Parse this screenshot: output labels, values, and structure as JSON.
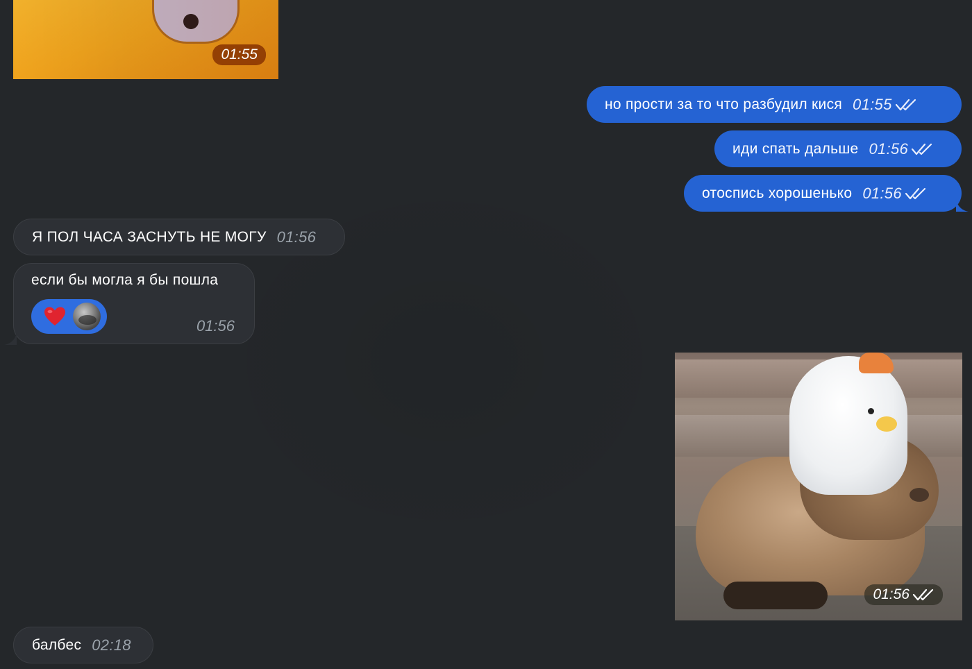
{
  "media_top": {
    "time": "01:55"
  },
  "outgoing": [
    {
      "text": "но прости за то что разбудил кися",
      "time": "01:55"
    },
    {
      "text": "иди спать дальше",
      "time": "01:56"
    },
    {
      "text": "отоспись хорошенько",
      "time": "01:56"
    }
  ],
  "incoming": [
    {
      "text": "Я ПОЛ ЧАСА ЗАСНУТЬ НЕ МОГУ",
      "time": "01:56"
    },
    {
      "text": "если бы могла я бы пошла",
      "time": "01:56",
      "reaction": "heart"
    },
    {
      "text": "балбес",
      "time": "02:18"
    }
  ],
  "photo": {
    "time": "01:56"
  },
  "colors": {
    "background": "#24272a",
    "outgoing_bubble": "#2563d3",
    "incoming_bubble": "#2d3035",
    "reaction_pill": "#2f6de0"
  },
  "icons": {
    "read_receipt": "double-check-icon",
    "reaction": "heart-icon"
  }
}
